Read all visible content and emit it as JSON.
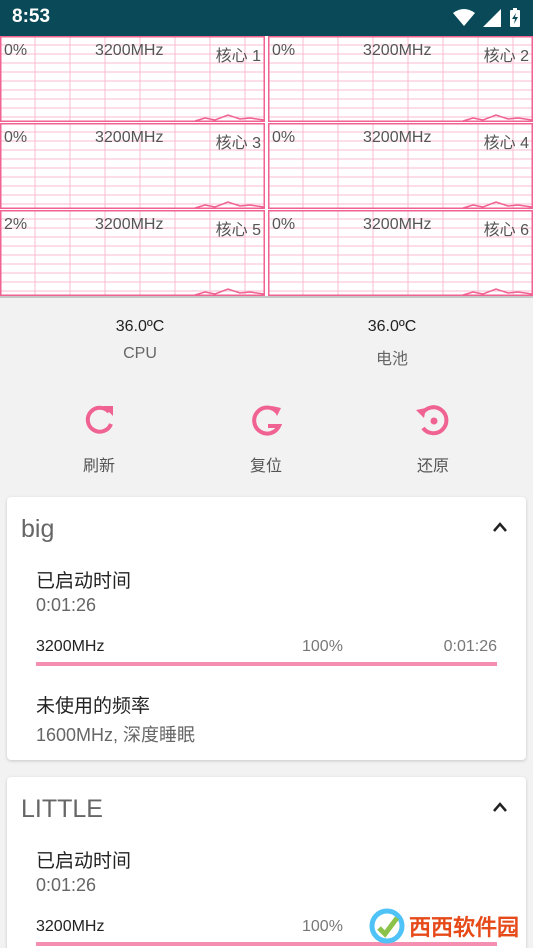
{
  "status_bar": {
    "time": "8:53"
  },
  "cores": [
    {
      "pct": "0%",
      "freq": "3200MHz",
      "name": "核心 1"
    },
    {
      "pct": "0%",
      "freq": "3200MHz",
      "name": "核心 2"
    },
    {
      "pct": "0%",
      "freq": "3200MHz",
      "name": "核心 3"
    },
    {
      "pct": "0%",
      "freq": "3200MHz",
      "name": "核心 4"
    },
    {
      "pct": "2%",
      "freq": "3200MHz",
      "name": "核心 5"
    },
    {
      "pct": "0%",
      "freq": "3200MHz",
      "name": "核心 6"
    }
  ],
  "temps": {
    "cpu": {
      "value": "36.0ºC",
      "label": "CPU"
    },
    "battery": {
      "value": "36.0ºC",
      "label": "电池"
    }
  },
  "actions": {
    "refresh": "刷新",
    "reset": "复位",
    "restore": "还原"
  },
  "clusters": [
    {
      "title": "big",
      "uptime_title": "已启动时间",
      "uptime": "0:01:26",
      "freq": "3200MHz",
      "percent": "100%",
      "time": "0:01:26",
      "fill": 1.0,
      "unused_title": "未使用的频率",
      "unused": "1600MHz, 深度睡眠"
    },
    {
      "title": "LITTLE",
      "uptime_title": "已启动时间",
      "uptime": "0:01:26",
      "freq": "3200MHz",
      "percent": "100%",
      "fill": 1.0
    }
  ],
  "colors": {
    "accent": "#f06292",
    "status_bar": "#0a4a58",
    "grid": "#f8bbd0"
  },
  "watermark": {
    "text": "西西软件园"
  }
}
